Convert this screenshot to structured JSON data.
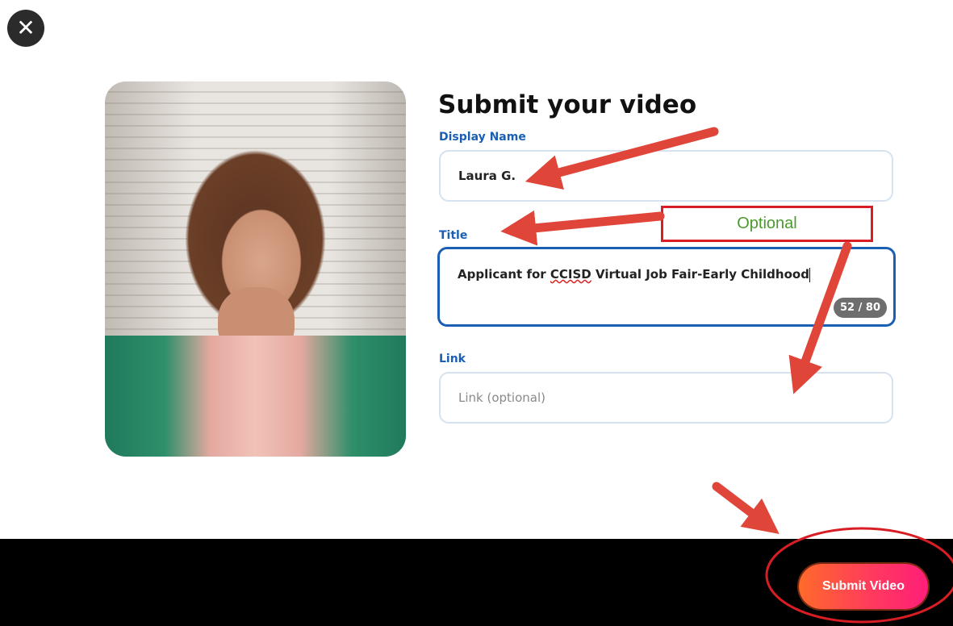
{
  "modal": {
    "close_icon": "close-icon",
    "heading": "Submit your video",
    "display_name": {
      "label": "Display Name",
      "value": "Laura G."
    },
    "title_field": {
      "label": "Title",
      "value_before": "Applicant for ",
      "value_misspelled": "CCISD",
      "value_after": " Virtual Job Fair-Early Childhood",
      "counter": "52 / 80"
    },
    "link_field": {
      "label": "Link",
      "placeholder": "Link (optional)",
      "value": ""
    },
    "submit_label": "Submit Video"
  },
  "annotations": {
    "optional_note": "Optional",
    "arrow_color": "#e0453a",
    "highlight_color": "#d81e24"
  },
  "colors": {
    "label_blue": "#1a5fb4",
    "focus_border": "#1a5fb4",
    "footer_bg": "#000000",
    "button_gradient_start": "#ff6a2a",
    "button_gradient_end": "#ff1e7a"
  }
}
